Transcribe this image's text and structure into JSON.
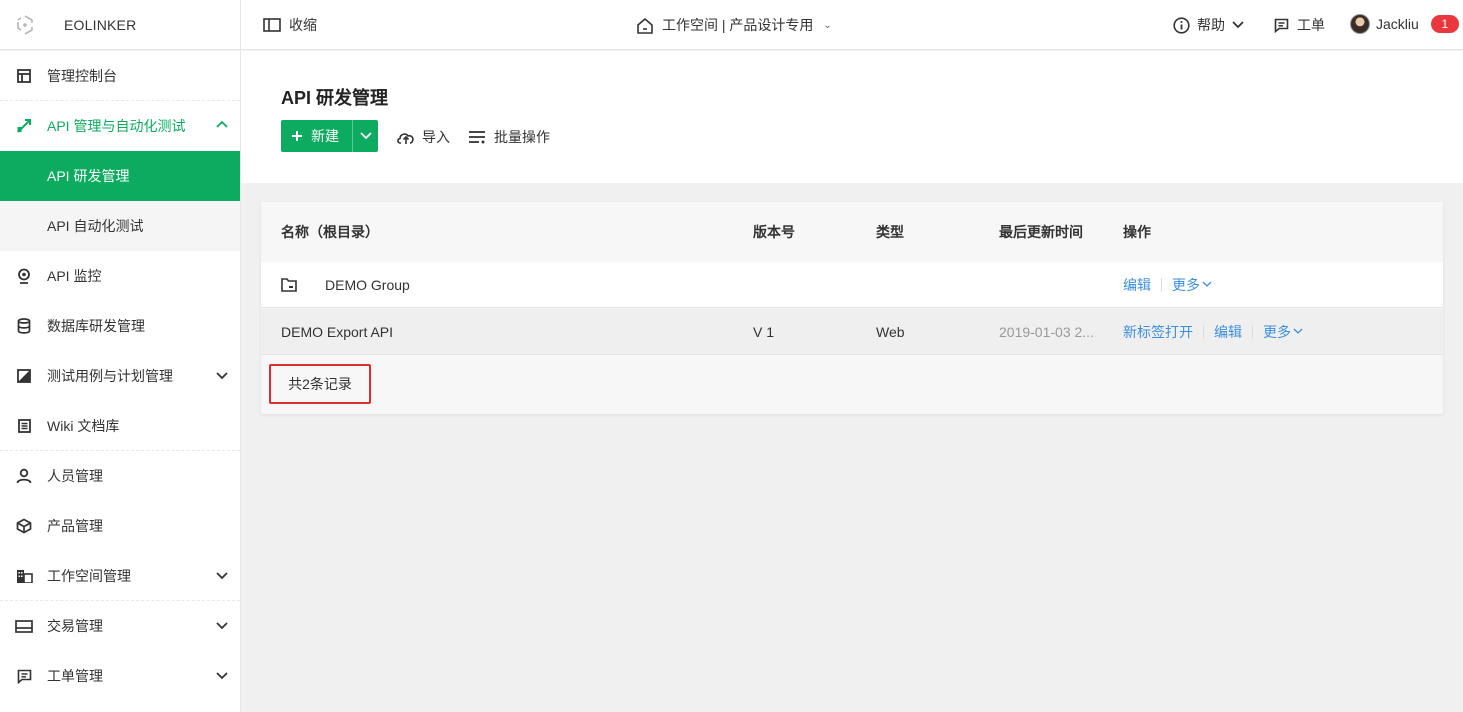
{
  "header": {
    "logo_text": "EOLINKER",
    "collapse_label": "收缩",
    "workspace_label": "工作空间 | 产品设计专用",
    "help_label": "帮助",
    "ticket_label": "工单",
    "user_name": "Jackliu",
    "notification_count": "1"
  },
  "sidebar": {
    "items": [
      {
        "label": "管理控制台",
        "icon": "dashboard-icon"
      },
      {
        "label": "API 管理与自动化测试",
        "icon": "api-icon",
        "expanded": true
      },
      {
        "label": "API 研发管理",
        "active": true
      },
      {
        "label": "API 自动化测试"
      },
      {
        "label": "API 监控",
        "icon": "monitor-icon"
      },
      {
        "label": "数据库研发管理",
        "icon": "database-icon"
      },
      {
        "label": "测试用例与计划管理",
        "icon": "testcase-icon"
      },
      {
        "label": "Wiki 文档库",
        "icon": "wiki-icon"
      },
      {
        "label": "人员管理",
        "icon": "people-icon"
      },
      {
        "label": "产品管理",
        "icon": "product-icon"
      },
      {
        "label": "工作空间管理",
        "icon": "building-icon"
      },
      {
        "label": "交易管理",
        "icon": "card-icon"
      },
      {
        "label": "工单管理",
        "icon": "ticket-icon"
      }
    ]
  },
  "main": {
    "title": "API 研发管理",
    "new_label": "新建",
    "import_label": "导入",
    "batch_label": "批量操作"
  },
  "table": {
    "headers": [
      "名称（根目录）",
      "版本号",
      "类型",
      "最后更新时间",
      "操作"
    ],
    "rows": [
      {
        "name": "DEMO Group",
        "version": "",
        "type": "",
        "updated": "",
        "actions": [
          "编辑",
          "更多"
        ]
      },
      {
        "name": "DEMO Export API",
        "version": "V 1",
        "type": "Web",
        "updated": "2019-01-03 2...",
        "actions": [
          "新标签打开",
          "编辑",
          "更多"
        ]
      }
    ],
    "total_label": "共2条记录"
  },
  "colors": {
    "accent": "#0cab5f",
    "link": "#3c8fe0",
    "badge": "#e8383d",
    "highlight_border": "#e32b2b"
  }
}
